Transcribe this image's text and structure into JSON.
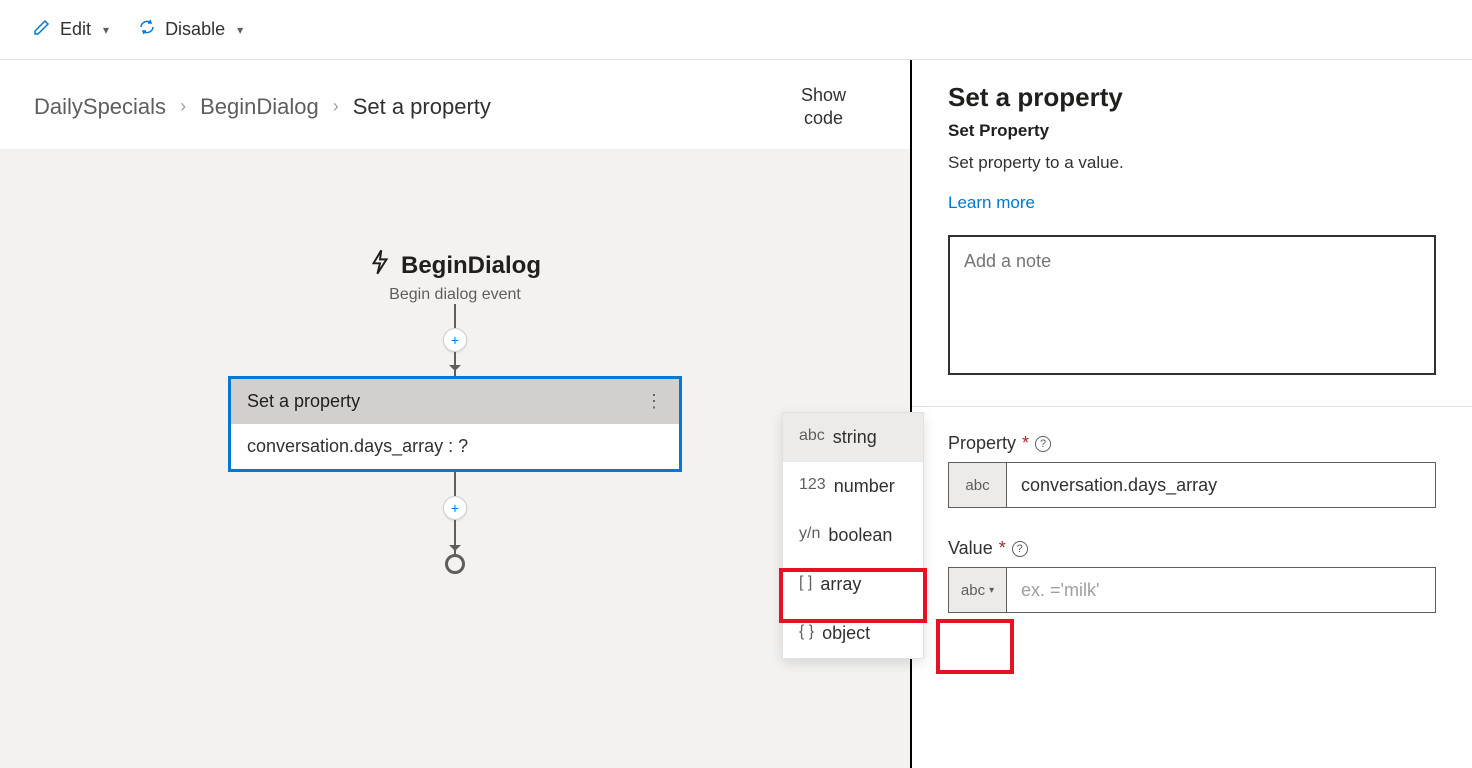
{
  "toolbar": {
    "edit": "Edit",
    "disable": "Disable"
  },
  "breadcrumb": {
    "a": "DailySpecials",
    "b": "BeginDialog",
    "c": "Set a property"
  },
  "showcode": "Show\ncode",
  "flow": {
    "begin_title": "BeginDialog",
    "begin_sub": "Begin dialog event",
    "node_title": "Set a property",
    "node_body": "conversation.days_array : ?"
  },
  "types": {
    "string_prefix": "abc",
    "string": "string",
    "number_prefix": "123",
    "number": "number",
    "boolean_prefix": "y/n",
    "boolean": "boolean",
    "array_prefix": "[ ]",
    "array": "array",
    "object_prefix": "{ }",
    "object": "object"
  },
  "panel": {
    "title": "Set a property",
    "subtitle": "Set Property",
    "desc": "Set property to a value.",
    "learn": "Learn more",
    "note_placeholder": "Add a note",
    "property_label": "Property",
    "property_prefix": "abc",
    "property_value": "conversation.days_array",
    "value_label": "Value",
    "value_prefix": "abc",
    "value_placeholder": "ex. ='milk'"
  }
}
